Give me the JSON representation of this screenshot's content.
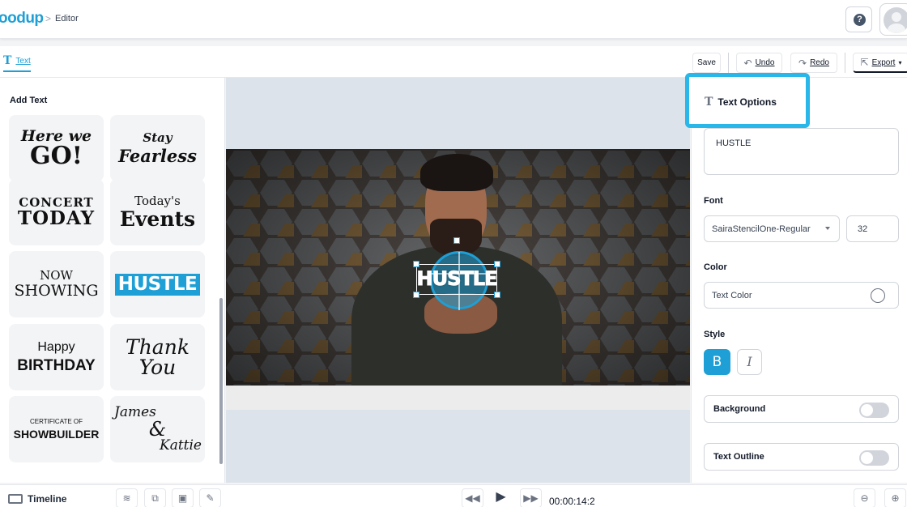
{
  "header": {
    "brand": "oodup",
    "breadcrumb_sep": ">",
    "breadcrumb": "Editor",
    "help_glyph": "?"
  },
  "toolbar": {
    "text_tab": "Text",
    "save": "Save",
    "undo": "Undo",
    "redo": "Redo",
    "export": "Export"
  },
  "left_panel": {
    "title": "Add Text",
    "tiles": [
      {
        "line1": "Here we",
        "line2": "GO!"
      },
      {
        "line1": "Stay",
        "line2": "Fearless"
      },
      {
        "line1": "CONCERT",
        "line2": "TODAY"
      },
      {
        "line1": "Today's",
        "line2": "Events"
      },
      {
        "line1": "NOW",
        "line2": "SHOWING"
      },
      {
        "line1": "HUSTLE",
        "line2": ""
      },
      {
        "line1": "Happy",
        "line2": "BIRTHDAY"
      },
      {
        "line1": "Thank",
        "line2": "You"
      },
      {
        "line1": "CERTIFICATE OF",
        "line2": "SHOWBUILDER"
      },
      {
        "line1": "James",
        "line2": "&",
        "line3": "Kattie"
      }
    ]
  },
  "canvas": {
    "overlay_text": "HUSTLE"
  },
  "right_panel": {
    "title": "Text Options",
    "text_value": "HUSTLE",
    "font_label": "Font",
    "font_value": "SairaStencilOne-Regular",
    "size_value": "32",
    "color_label": "Color",
    "color_value": "Text Color",
    "style_label": "Style",
    "bold": "B",
    "italic": "I",
    "background_label": "Background",
    "outline_label": "Text Outline"
  },
  "bottom": {
    "timeline": "Timeline",
    "time": "00:00:14:2"
  },
  "colors": {
    "accent": "#1e9fd6",
    "highlight": "#29b6e8"
  }
}
